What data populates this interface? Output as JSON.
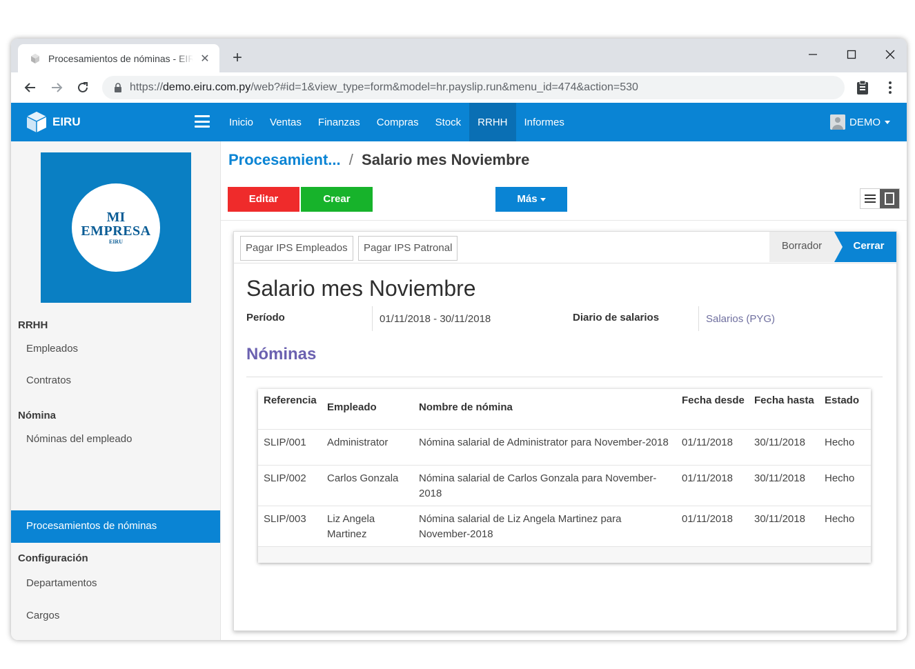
{
  "browser": {
    "tab_title": "Procesamientos de nóminas - EIRU",
    "new_tab": "+",
    "url_scheme": "https://",
    "url_host": "demo.eiru.com.py",
    "url_path": "/web?#id=1&view_type=form&model=hr.payslip.run&menu_id=474&action=530"
  },
  "navbar": {
    "brand": "EIRU",
    "menu": [
      "Inicio",
      "Ventas",
      "Finanzas",
      "Compras",
      "Stock",
      "RRHH",
      "Informes"
    ],
    "active_menu": "RRHH",
    "user": "DEMO",
    "accent": "#0a84d4"
  },
  "sidebar": {
    "logo_line1": "MI",
    "logo_line2": "EMPRESA",
    "logo_line3": "EIRU",
    "sections": [
      {
        "title": "RRHH",
        "items": [
          "Empleados",
          "Contratos"
        ]
      },
      {
        "title": "Nómina",
        "items": [
          "Nóminas del empleado",
          "Procesamientos de nóminas"
        ]
      },
      {
        "title": "Configuración",
        "items": [
          "Departamentos",
          "Cargos"
        ]
      }
    ],
    "active_item": "Procesamientos de nóminas"
  },
  "breadcrumb": {
    "parent": "Procesamient...",
    "separator": "/",
    "current": "Salario mes Noviembre"
  },
  "buttons": {
    "edit": "Editar",
    "create": "Crear",
    "more": "Más"
  },
  "statusbar": {
    "pay_employees": "Pagar IPS Empleados",
    "pay_employer": "Pagar IPS Patronal",
    "stage_draft": "Borrador",
    "stage_close": "Cerrar"
  },
  "record": {
    "title": "Salario mes Noviembre",
    "period_label": "Período",
    "period_from": "01/11/2018",
    "period_sep": "-",
    "period_to": "30/11/2018",
    "journal_label": "Diario de salarios",
    "journal_value": "Salarios (PYG)",
    "section_title": "Nóminas"
  },
  "payslips": {
    "columns": [
      "Referencia",
      "Empleado",
      "Nombre de nómina",
      "Fecha desde",
      "Fecha hasta",
      "Estado"
    ],
    "rows": [
      [
        "SLIP/001",
        "Administrator",
        "Nómina salarial de Administrator para November-2018",
        "01/11/2018",
        "30/11/2018",
        "Hecho"
      ],
      [
        "SLIP/002",
        "Carlos Gonzala",
        "Nómina salarial de Carlos Gonzala para November-2018",
        "01/11/2018",
        "30/11/2018",
        "Hecho"
      ],
      [
        "SLIP/003",
        "Liz Angela Martinez",
        "Nómina salarial de Liz Angela Martinez para November-2018",
        "01/11/2018",
        "30/11/2018",
        "Hecho"
      ]
    ]
  }
}
